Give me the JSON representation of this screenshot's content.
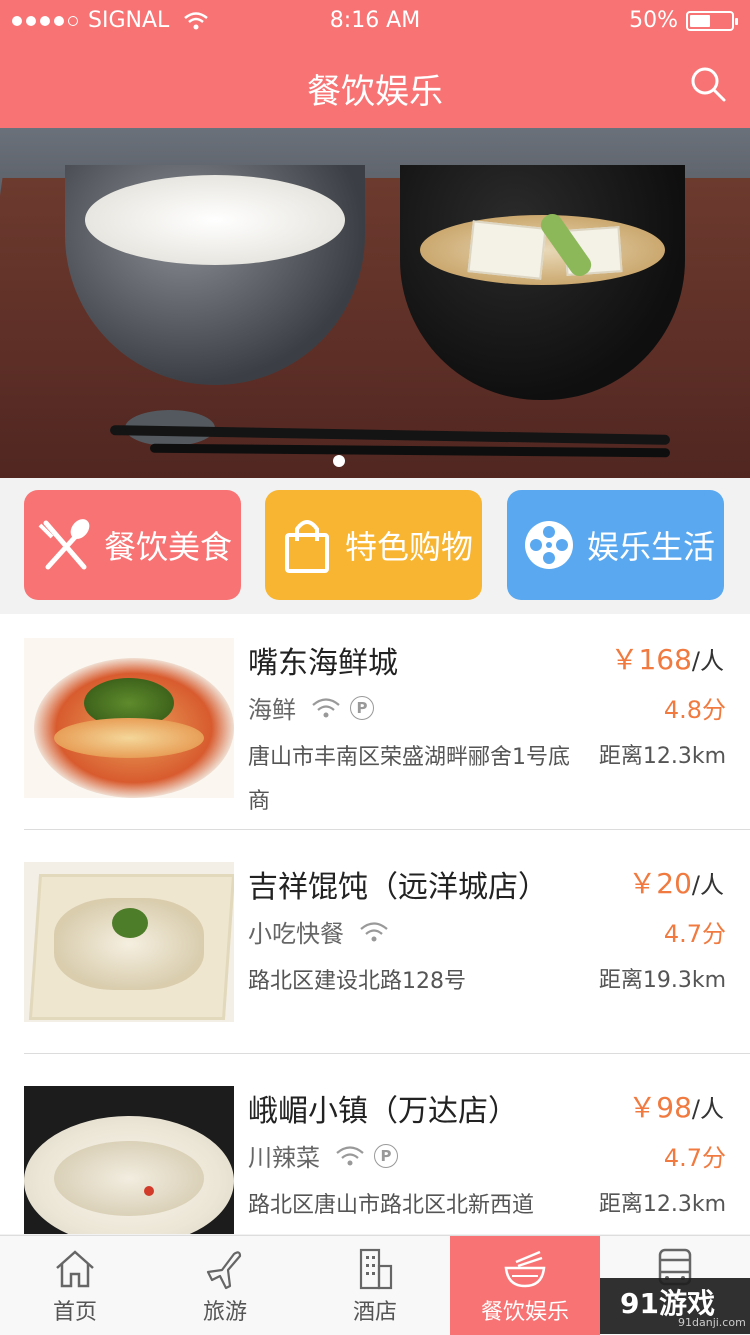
{
  "status_bar": {
    "carrier": "SIGNAL",
    "time": "8:16 AM",
    "battery": "50%",
    "battery_level": 0.5
  },
  "header": {
    "title": "餐饮娱乐",
    "search_icon": "search-icon"
  },
  "banner": {
    "page_count": 1,
    "active_index": 0
  },
  "categories": [
    {
      "label": "餐饮美食",
      "icon": "fork-spoon-icon",
      "color": "#f87474"
    },
    {
      "label": "特色购物",
      "icon": "shopping-bag-icon",
      "color": "#f7b532"
    },
    {
      "label": "娱乐生活",
      "icon": "film-reel-icon",
      "color": "#5aa9f0"
    }
  ],
  "restaurants": [
    {
      "name": "嘴东海鲜城",
      "price": "￥168",
      "unit": "/人",
      "category": "海鲜",
      "wifi": true,
      "parking": true,
      "parking_label": "P",
      "rating": "4.8分",
      "address": "唐山市丰南区荣盛湖畔郦舍1号底商",
      "distance": "距离12.3km"
    },
    {
      "name": "吉祥馄饨（远洋城店）",
      "price": "￥20",
      "unit": "/人",
      "category": "小吃快餐",
      "wifi": true,
      "parking": false,
      "parking_label": "",
      "rating": "4.7分",
      "address": "路北区建设北路128号",
      "distance": "距离19.3km"
    },
    {
      "name": "峨嵋小镇（万达店）",
      "price": "￥98",
      "unit": "/人",
      "category": "川辣菜",
      "wifi": true,
      "parking": true,
      "parking_label": "P",
      "rating": "4.7分",
      "address": "路北区唐山市路北区北新西道",
      "distance": "距离12.3km"
    }
  ],
  "tabbar": [
    {
      "label": "首页",
      "icon": "home-icon",
      "active": false
    },
    {
      "label": "旅游",
      "icon": "airplane-icon",
      "active": false
    },
    {
      "label": "酒店",
      "icon": "building-icon",
      "active": false
    },
    {
      "label": "餐饮娱乐",
      "icon": "bowl-icon",
      "active": true
    },
    {
      "label": "",
      "icon": "bus-icon",
      "active": false
    }
  ],
  "watermark": {
    "text": "91游戏",
    "sub": "91danji.com"
  }
}
